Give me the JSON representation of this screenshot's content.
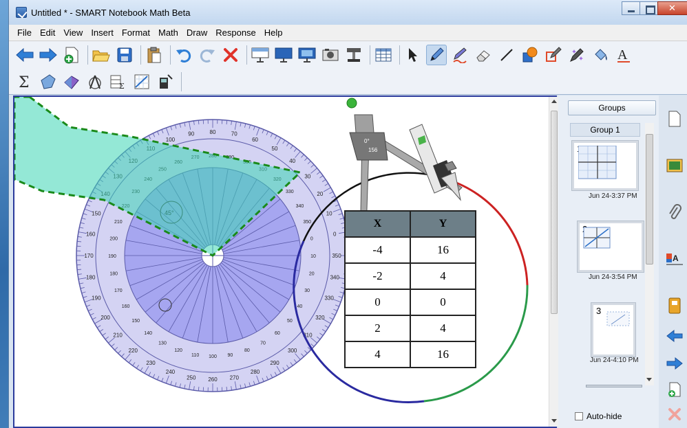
{
  "window": {
    "title": "Untitled * - SMART Notebook Math Beta"
  },
  "menu": [
    "File",
    "Edit",
    "View",
    "Insert",
    "Format",
    "Math",
    "Draw",
    "Response",
    "Help"
  ],
  "protractor": {
    "angle_label": "45°",
    "outer_ticks_labels": [
      "0",
      "10",
      "20",
      "30",
      "40",
      "50",
      "60",
      "70",
      "80",
      "90",
      "100",
      "110",
      "120",
      "130",
      "140",
      "150",
      "160",
      "170",
      "180",
      "190",
      "200",
      "210",
      "220",
      "230",
      "240",
      "250",
      "260",
      "270",
      "280",
      "290",
      "300",
      "310",
      "320",
      "330",
      "340",
      "350",
      "360"
    ]
  },
  "compass": {
    "angle": "0°",
    "radius": "156"
  },
  "table": {
    "headers": [
      "X",
      "Y"
    ],
    "rows": [
      [
        "-4",
        "16"
      ],
      [
        "-2",
        "4"
      ],
      [
        "0",
        "0"
      ],
      [
        "2",
        "4"
      ],
      [
        "4",
        "16"
      ]
    ]
  },
  "side_panel": {
    "groups_label": "Groups",
    "group_name": "Group 1",
    "pages": [
      {
        "num": "1",
        "time": "Jun 24-3:37 PM"
      },
      {
        "num": "2",
        "time": "Jun 24-3:54 PM"
      },
      {
        "num": "3",
        "time": "Jun 24-4:10 PM"
      }
    ],
    "autohide_label": "Auto-hide"
  },
  "colors": {
    "accent": "#2a3a9c",
    "shape_fill": "#3cd6b4",
    "shape_border": "#1a8a1a",
    "protractor_inner": "#a6a6f0",
    "arc_red": "#cc2222",
    "arc_green": "#2a9a4a",
    "arc_blue": "#2a2aa0"
  }
}
